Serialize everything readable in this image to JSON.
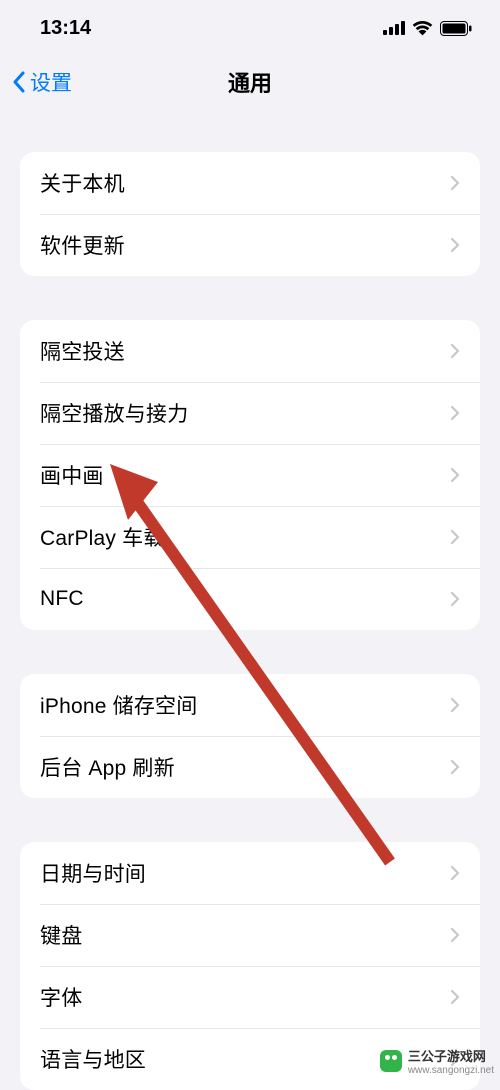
{
  "statusBar": {
    "time": "13:14"
  },
  "nav": {
    "back": "设置",
    "title": "通用"
  },
  "groups": {
    "g0": {
      "r0": "关于本机",
      "r1": "软件更新"
    },
    "g1": {
      "r0": "隔空投送",
      "r1": "隔空播放与接力",
      "r2": "画中画",
      "r3": "CarPlay 车载",
      "r4": "NFC"
    },
    "g2": {
      "r0": "iPhone 储存空间",
      "r1": "后台 App 刷新"
    },
    "g3": {
      "r0": "日期与时间",
      "r1": "键盘",
      "r2": "字体",
      "r3": "语言与地区"
    }
  },
  "watermark": {
    "text": "三公子游戏网",
    "url": "www.sangongzi.net"
  }
}
